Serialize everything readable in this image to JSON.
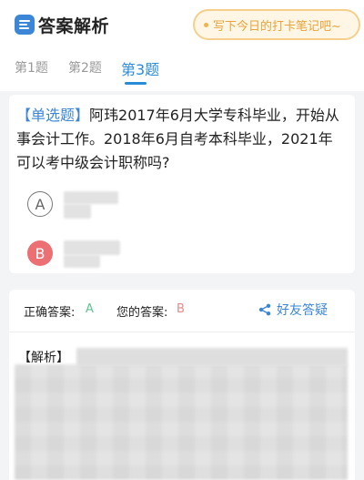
{
  "header": {
    "title": "答案解析",
    "note_prompt": "写下今日的打卡笔记吧~"
  },
  "tabs": [
    {
      "label": "第1题"
    },
    {
      "label": "第2题"
    },
    {
      "label": "第3题"
    }
  ],
  "question": {
    "type_tag": "【单选题】",
    "text": "阿玮2017年6月大学专科毕业，开始从事会计工作。2018年6月自考本科毕业，2021年可以考中级会计职称吗?",
    "options": [
      {
        "letter": "A",
        "text": ""
      },
      {
        "letter": "B",
        "text": ""
      }
    ]
  },
  "answer": {
    "correct_label": "正确答案:",
    "correct_value": "A",
    "my_label": "您的答案:",
    "my_value": "B",
    "friend_button": "好友答疑",
    "analysis_label": "【解析】"
  },
  "colors": {
    "accent": "#2a8bd8",
    "correct": "#5cc58e",
    "wrong": "#ec6f74",
    "note_text": "#e8a33c"
  },
  "icons": {
    "app": "answer-app-icon",
    "share": "share-icon"
  }
}
